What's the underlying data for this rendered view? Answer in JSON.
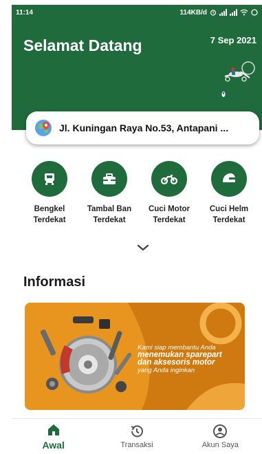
{
  "status_bar": {
    "time": "11:14",
    "network_speed": "114KB/d",
    "icons": [
      "alarm-icon",
      "signal-icon",
      "signal-icon",
      "wifi-icon",
      "battery-icon"
    ]
  },
  "header": {
    "greeting": "Selamat Datang",
    "date": "7 Sep 2021"
  },
  "location": {
    "address": "Jl. Kuningan Raya No.53, Antapani ...",
    "icon": "globe-location-icon"
  },
  "menu": [
    {
      "label_line1": "Bengkel",
      "label_line2": "Terdekat",
      "icon": "workshop-icon"
    },
    {
      "label_line1": "Tambal Ban",
      "label_line2": "Terdekat",
      "icon": "toolbox-icon"
    },
    {
      "label_line1": "Cuci Motor",
      "label_line2": "Terdekat",
      "icon": "motorcycle-icon"
    },
    {
      "label_line1": "Cuci Helm",
      "label_line2": "Terdekat",
      "icon": "helmet-icon"
    }
  ],
  "info": {
    "title": "Informasi",
    "banner": {
      "line1": "Kami siap membantu Anda",
      "line2": "menemukan sparepart",
      "line3": "dan aksesoris motor",
      "line4": "yang Anda inginkan"
    }
  },
  "bottom_nav": [
    {
      "label": "Awal",
      "icon": "home-icon",
      "active": true
    },
    {
      "label": "Transaksi",
      "icon": "history-icon",
      "active": false
    },
    {
      "label": "Akun Saya",
      "icon": "account-icon",
      "active": false
    }
  ],
  "colors": {
    "primary": "#1f6b3c",
    "banner_orange": "#e8951f"
  }
}
